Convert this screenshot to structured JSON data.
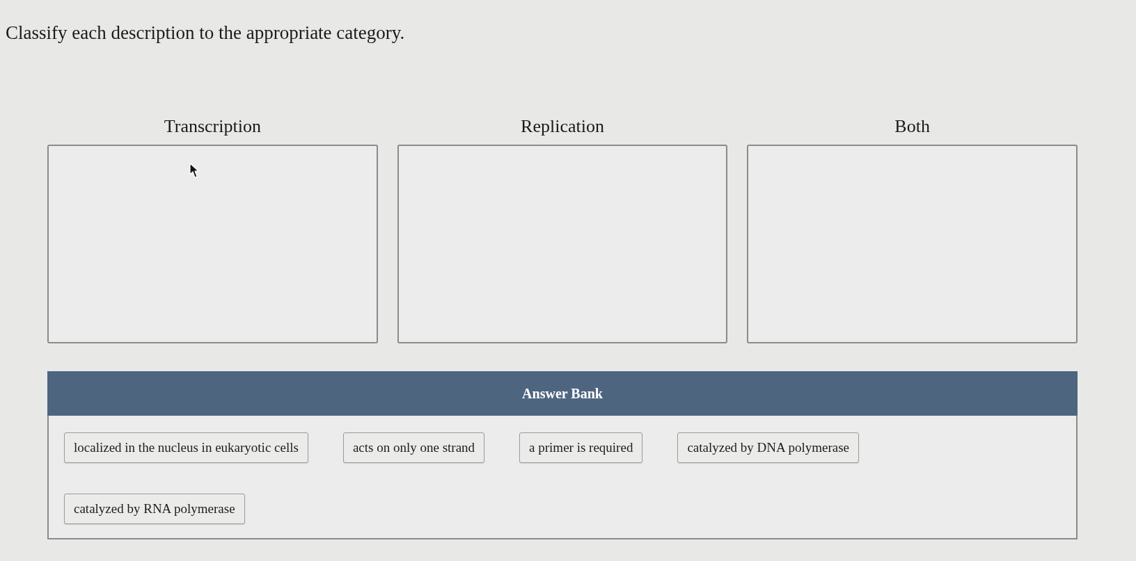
{
  "instruction": "Classify each description to the appropriate category.",
  "categories": [
    {
      "label": "Transcription"
    },
    {
      "label": "Replication"
    },
    {
      "label": "Both"
    }
  ],
  "answer_bank": {
    "title": "Answer Bank",
    "items": [
      "localized in the nucleus in eukaryotic cells",
      "acts on only one strand",
      "a primer is required",
      "catalyzed by DNA polymerase",
      "catalyzed by RNA polymerase"
    ]
  }
}
